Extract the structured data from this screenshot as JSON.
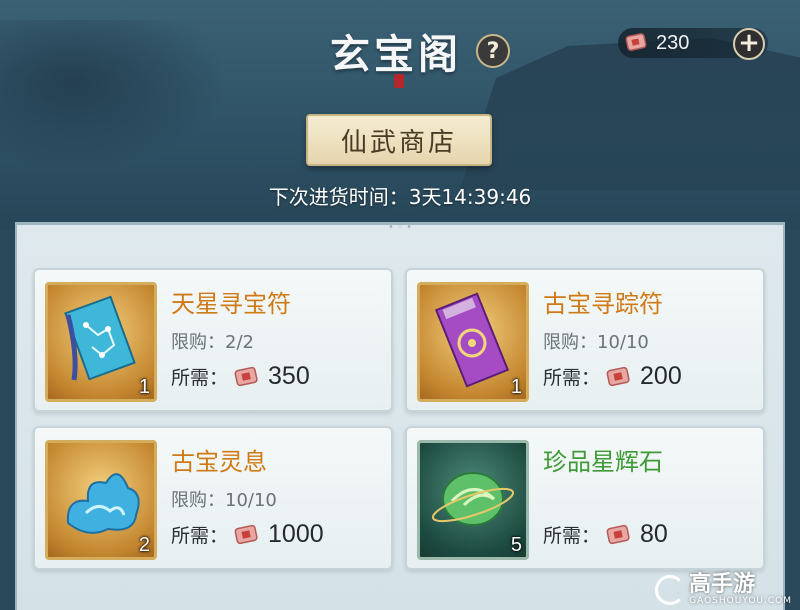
{
  "header": {
    "title": "玄宝阁",
    "help_label": "?",
    "currency": {
      "icon": "ticket-icon",
      "amount": "230"
    },
    "add_label": "+"
  },
  "shop": {
    "tab_label": "仙武商店",
    "restock_text": "下次进货时间：3天14:39:46"
  },
  "items": [
    {
      "name": "天星寻宝符",
      "name_color": "#d07a16",
      "limit": "限购：2/2",
      "price_label": "所需：",
      "price": "350",
      "count": "1",
      "icon": "blue-talisman-icon",
      "frame": "gold"
    },
    {
      "name": "古宝寻踪符",
      "name_color": "#d07a16",
      "limit": "限购：10/10",
      "price_label": "所需：",
      "price": "200",
      "count": "1",
      "icon": "purple-talisman-icon",
      "frame": "gold"
    },
    {
      "name": "古宝灵息",
      "name_color": "#d07a16",
      "limit": "限购：10/10",
      "price_label": "所需：",
      "price": "1000",
      "count": "2",
      "icon": "blue-cloud-icon",
      "frame": "gold"
    },
    {
      "name": "珍品星辉石",
      "name_color": "#3d9a35",
      "limit": "",
      "price_label": "所需：",
      "price": "80",
      "count": "5",
      "icon": "green-stone-icon",
      "frame": "green"
    }
  ],
  "watermark": {
    "text": "高手游",
    "sub": "GAOSHOUYOU.COM"
  }
}
